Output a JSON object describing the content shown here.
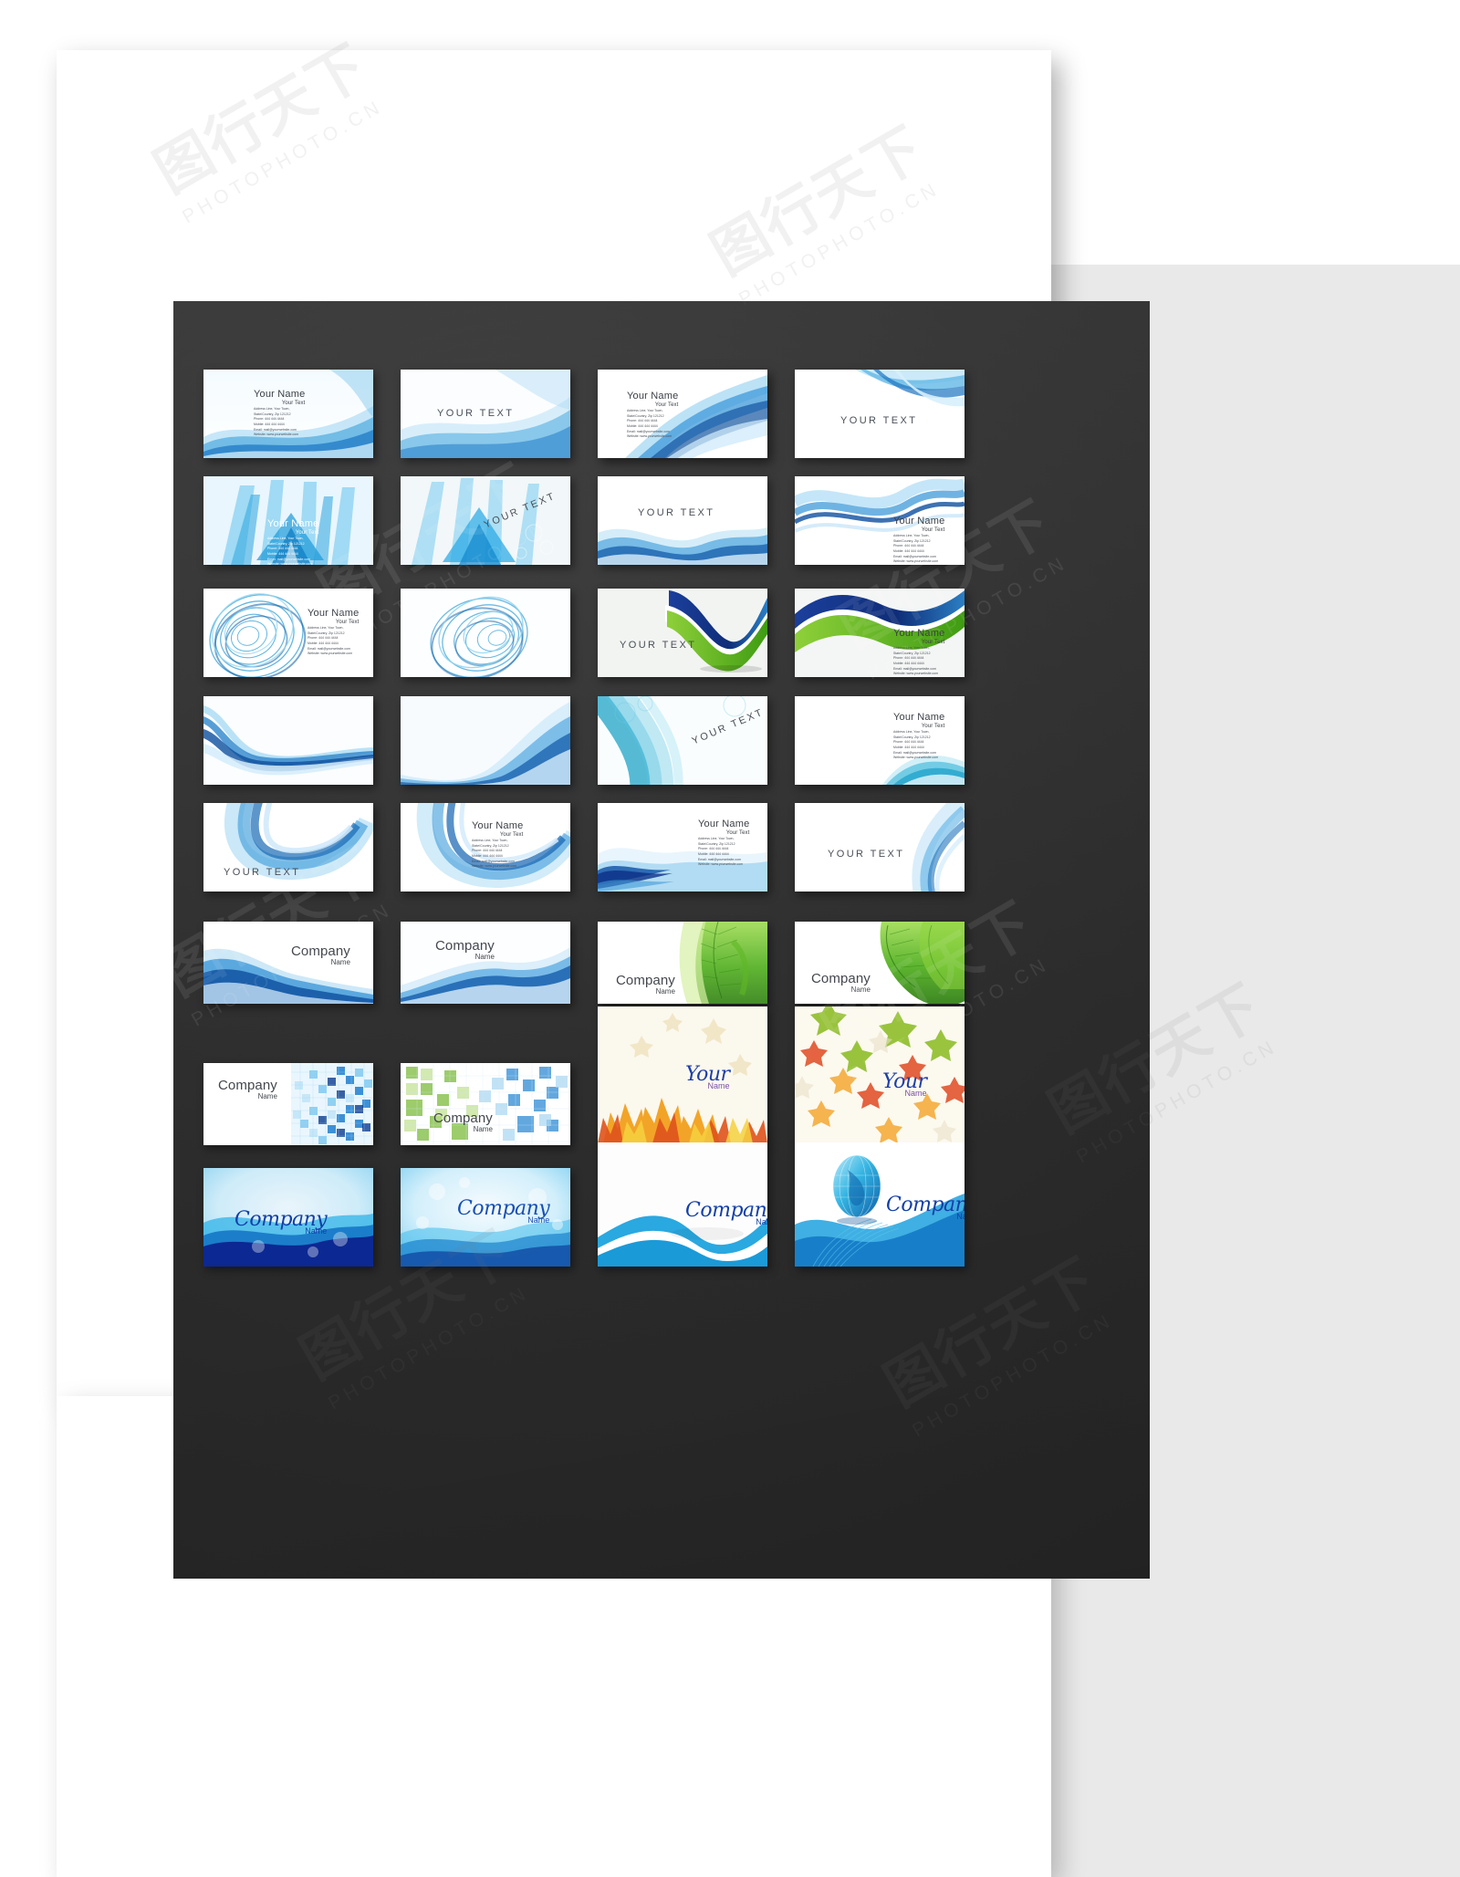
{
  "page": {
    "background_color": "#ffffff",
    "board_color": "#333333",
    "paper_color": "#ffffff"
  },
  "watermark": {
    "chinese": "图行天下",
    "latin": "PHOTOPHOTO.CN"
  },
  "labels": {
    "your_name": "Your Name",
    "your_text_sub": "Your Text",
    "your_text": "YOUR TEXT",
    "company": "Company",
    "name": "Name",
    "your_script": "Your",
    "company_script": "Company"
  },
  "address_block": {
    "line1": "Address Line, Your Town,",
    "line2": "State/Country,  Zip 121212",
    "line3": "Phone:  444  444  4444",
    "line4": "Mobile:  444  444  4444",
    "line5": "Email:  mail@yourwebsite.com",
    "line6": "Website: www.yourwebsite.com"
  },
  "colors": {
    "blue_deep": "#1055a8",
    "blue_mid": "#2f8fd8",
    "blue_light": "#9ed4f2",
    "cyan": "#3fc3e8",
    "green": "#62bb22",
    "navy": "#10307e",
    "leaf_green": "#4aa81f",
    "autumn_orange": "#f08a1c",
    "autumn_red": "#d6392a",
    "text_gray": "#4a4f57"
  },
  "cards": [
    {
      "id": 1,
      "row": 1,
      "col": 1,
      "style": "wave-blue-light",
      "has_name": true,
      "has_address": true,
      "has_your_text": false,
      "text_color": "dark"
    },
    {
      "id": 2,
      "row": 1,
      "col": 2,
      "style": "wave-blue-soft",
      "has_name": false,
      "has_address": false,
      "has_your_text": true,
      "text_color": "dark"
    },
    {
      "id": 3,
      "row": 1,
      "col": 3,
      "style": "wave-blue-diag",
      "has_name": true,
      "has_address": true,
      "has_your_text": false,
      "text_color": "dark"
    },
    {
      "id": 4,
      "row": 1,
      "col": 4,
      "style": "wave-blue-topright",
      "has_name": false,
      "has_address": false,
      "has_your_text": true,
      "text_color": "dark"
    },
    {
      "id": 5,
      "row": 2,
      "col": 1,
      "style": "burst-arrows",
      "has_name": true,
      "has_address": true,
      "has_your_text": false,
      "text_color": "white"
    },
    {
      "id": 6,
      "row": 2,
      "col": 2,
      "style": "burst-arrows-2",
      "has_name": false,
      "has_address": false,
      "has_your_text": true,
      "text_color": "dark",
      "rotated": true
    },
    {
      "id": 7,
      "row": 2,
      "col": 3,
      "style": "wave-bottom-ribbon",
      "has_name": false,
      "has_address": false,
      "has_your_text": true,
      "text_color": "dark"
    },
    {
      "id": 8,
      "row": 2,
      "col": 4,
      "style": "wave-ribbon-right",
      "has_name": true,
      "has_address": true,
      "has_your_text": false,
      "text_color": "dark"
    },
    {
      "id": 9,
      "row": 3,
      "col": 1,
      "style": "spiral-vortex",
      "has_name": true,
      "has_address": true,
      "has_your_text": false,
      "text_color": "dark"
    },
    {
      "id": 10,
      "row": 3,
      "col": 2,
      "style": "spiral-vortex-2",
      "has_name": false,
      "has_address": false,
      "has_your_text": false,
      "text_color": "dark"
    },
    {
      "id": 11,
      "row": 3,
      "col": 3,
      "style": "swoosh-green-blue",
      "has_name": false,
      "has_address": false,
      "has_your_text": true,
      "text_color": "dark"
    },
    {
      "id": 12,
      "row": 3,
      "col": 4,
      "style": "swoosh-green-blue-2",
      "has_name": true,
      "has_address": true,
      "has_your_text": false,
      "text_color": "dark"
    },
    {
      "id": 13,
      "row": 4,
      "col": 1,
      "style": "wave-blue-streak",
      "has_name": false,
      "has_address": false,
      "has_your_text": false,
      "text_color": "dark"
    },
    {
      "id": 14,
      "row": 4,
      "col": 2,
      "style": "wave-blue-corner",
      "has_name": false,
      "has_address": false,
      "has_your_text": false,
      "text_color": "dark"
    },
    {
      "id": 15,
      "row": 4,
      "col": 3,
      "style": "arc-cyan-nested",
      "has_name": false,
      "has_address": false,
      "has_your_text": true,
      "text_color": "dark",
      "rotated": true
    },
    {
      "id": 16,
      "row": 4,
      "col": 4,
      "style": "arc-cyan-bottom",
      "has_name": true,
      "has_address": true,
      "has_your_text": false,
      "text_color": "dark"
    },
    {
      "id": 17,
      "row": 5,
      "col": 1,
      "style": "arc-blue-loop",
      "has_name": false,
      "has_address": false,
      "has_your_text": true,
      "text_color": "dark"
    },
    {
      "id": 18,
      "row": 5,
      "col": 2,
      "style": "arc-blue-loop-2",
      "has_name": true,
      "has_address": true,
      "has_your_text": false,
      "text_color": "dark"
    },
    {
      "id": 19,
      "row": 5,
      "col": 3,
      "style": "wave-blue-lowband",
      "has_name": true,
      "has_address": true,
      "has_your_text": false,
      "text_color": "dark"
    },
    {
      "id": 20,
      "row": 5,
      "col": 4,
      "style": "wave-blue-soft-right",
      "has_name": false,
      "has_address": false,
      "has_your_text": true,
      "text_color": "dark"
    },
    {
      "id": 21,
      "row": 6,
      "col": 1,
      "style": "company-wave-blue",
      "has_company": true
    },
    {
      "id": 22,
      "row": 6,
      "col": 2,
      "style": "company-wave-blue-2",
      "has_company": true
    },
    {
      "id": 23,
      "row": 6,
      "col": 3,
      "style": "company-leaf-green",
      "has_company": true
    },
    {
      "id": 24,
      "row": 6,
      "col": 4,
      "style": "company-leaf-green-2",
      "has_company": true
    },
    {
      "id": 25,
      "row": 7,
      "col": 1,
      "style": "company-mosaic-blue",
      "has_company": true
    },
    {
      "id": 26,
      "row": 7,
      "col": 2,
      "style": "company-mosaic-green",
      "has_company": true
    },
    {
      "id": 27,
      "row": 7,
      "col": 3,
      "style": "autumn-maple",
      "has_script_your": true
    },
    {
      "id": 28,
      "row": 7,
      "col": 4,
      "style": "autumn-stars",
      "has_script_your": true
    },
    {
      "id": 29,
      "row": 8,
      "col": 1,
      "style": "script-wave-deepblue",
      "has_script_company": true
    },
    {
      "id": 30,
      "row": 8,
      "col": 2,
      "style": "script-wave-bokeh",
      "has_script_company": true
    },
    {
      "id": 31,
      "row": 8,
      "col": 3,
      "style": "script-wave-swoosh",
      "has_script_company": true
    },
    {
      "id": 32,
      "row": 8,
      "col": 4,
      "style": "script-globe",
      "has_script_company": true
    }
  ]
}
